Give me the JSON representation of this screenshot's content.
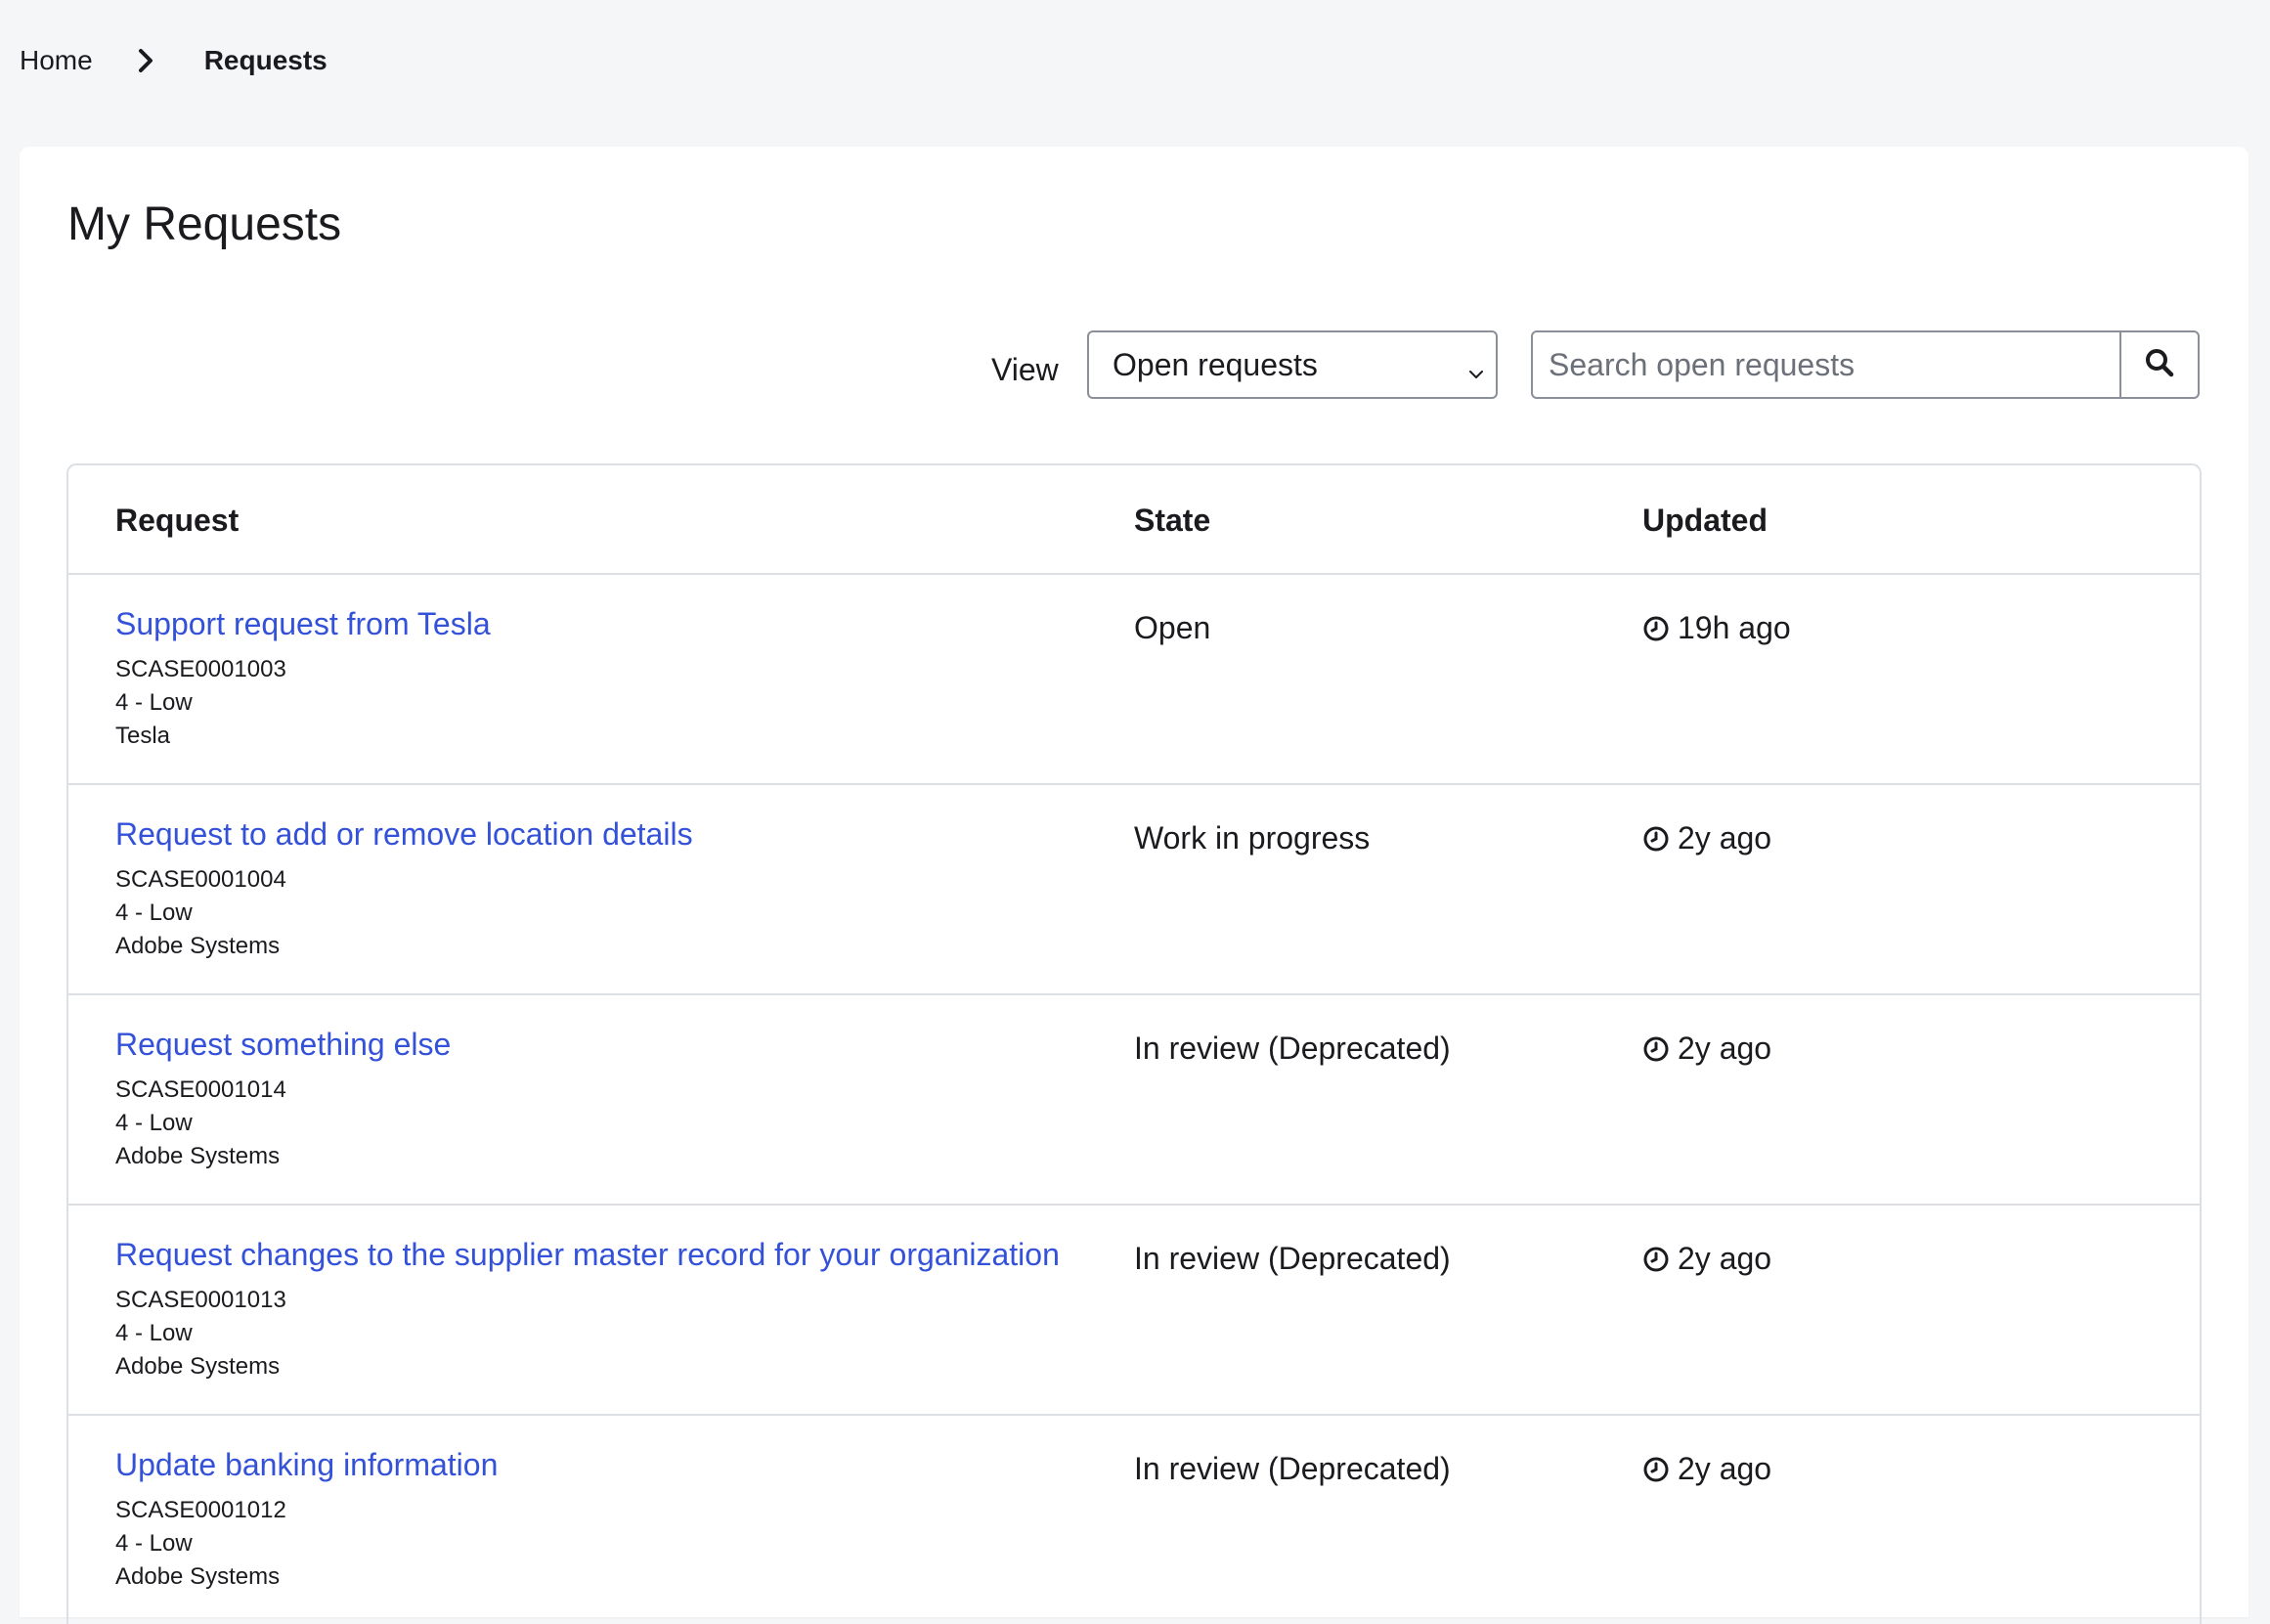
{
  "breadcrumb": {
    "home": "Home",
    "current": "Requests"
  },
  "page": {
    "title": "My Requests"
  },
  "filter": {
    "view_label": "View",
    "selected_view": "Open requests",
    "search_placeholder": "Search open requests"
  },
  "table": {
    "headers": {
      "request": "Request",
      "state": "State",
      "updated": "Updated"
    },
    "rows": [
      {
        "title": "Support request from Tesla",
        "number": "SCASE0001003",
        "priority": "4 - Low",
        "organization": "Tesla",
        "state": "Open",
        "updated": "19h ago"
      },
      {
        "title": "Request to add or remove location details",
        "number": "SCASE0001004",
        "priority": "4 - Low",
        "organization": "Adobe Systems",
        "state": "Work in progress",
        "updated": "2y ago"
      },
      {
        "title": "Request something else",
        "number": "SCASE0001014",
        "priority": "4 - Low",
        "organization": "Adobe Systems",
        "state": "In review (Deprecated)",
        "updated": "2y ago"
      },
      {
        "title": "Request changes to the supplier master record for your organization",
        "number": "SCASE0001013",
        "priority": "4 - Low",
        "organization": "Adobe Systems",
        "state": "In review (Deprecated)",
        "updated": "2y ago"
      },
      {
        "title": "Update banking information",
        "number": "SCASE0001012",
        "priority": "4 - Low",
        "organization": "Adobe Systems",
        "state": "In review (Deprecated)",
        "updated": "2y ago"
      }
    ]
  },
  "colors": {
    "link": "#3451d9",
    "page_background": "#f5f6f8",
    "card_background": "#ffffff",
    "border": "#dcdfe4"
  },
  "icons": {
    "breadcrumb_separator": "chevron-right-icon",
    "select_toggle": "chevron-down-icon",
    "search": "search-icon",
    "updated": "clock-icon"
  }
}
